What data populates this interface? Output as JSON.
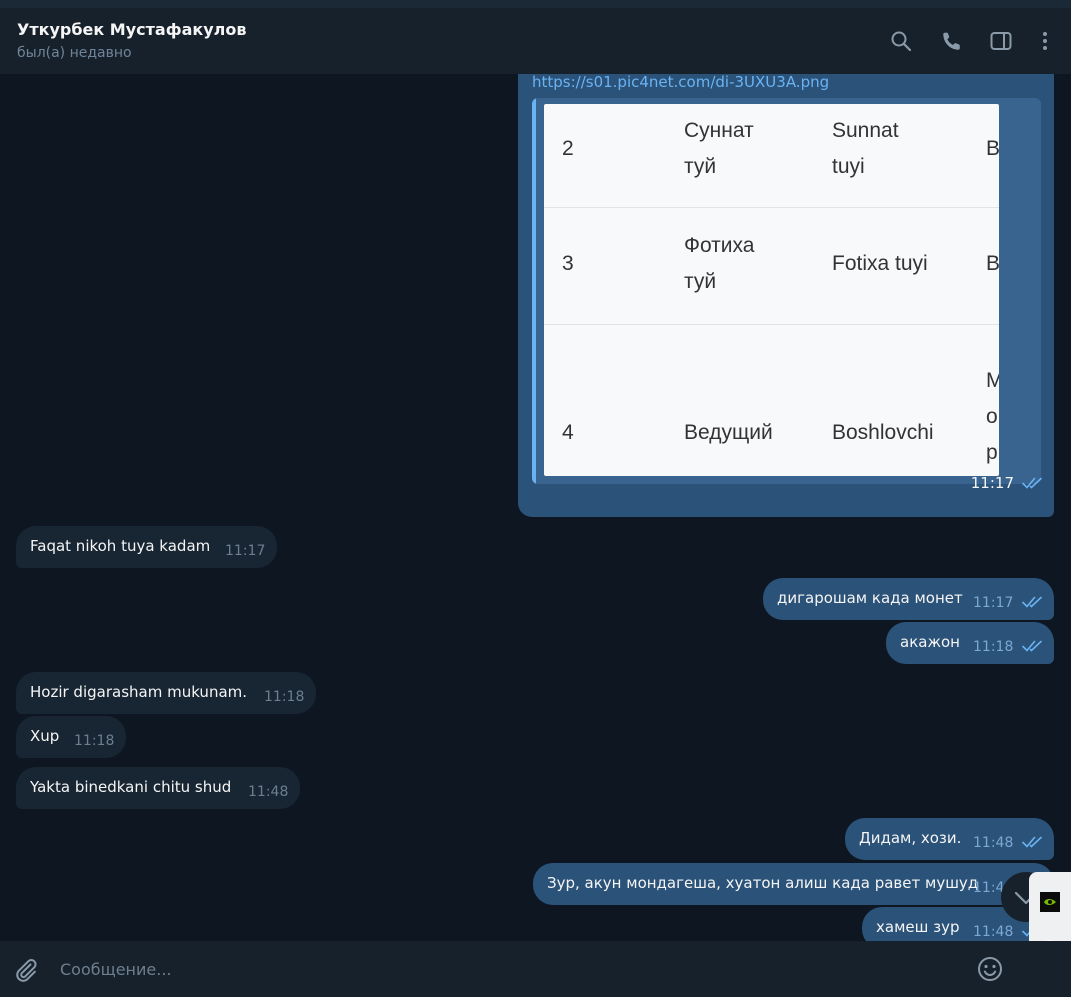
{
  "header": {
    "name": "Уткурбек Мустафакулов",
    "status": "был(а) недавно",
    "icons": [
      "search-icon",
      "phone-icon",
      "sidebar-toggle-icon",
      "more-vert-icon"
    ]
  },
  "link_message": {
    "url": "https://s01.pic4net.com/di-3UXU3A.png",
    "time": "11:17",
    "table_rows": [
      {
        "num": "2",
        "ru_1": "Суннат",
        "ru_2": "туй",
        "uz_1": "Sunnat",
        "uz_2": "tuyi",
        "extra": "B"
      },
      {
        "num": "3",
        "ru_1": "Фотиха",
        "ru_2": "туй",
        "uz_1": "Fotixa tuyi",
        "uz_2": "",
        "extra": "B"
      },
      {
        "num": "4",
        "ru_1": "Ведущий",
        "ru_2": "",
        "uz_1": "Boshlovchi",
        "uz_2": "",
        "extra_1": "M",
        "extra_2": "o",
        "extra_3": "p"
      }
    ]
  },
  "messages": [
    {
      "text": "Faqat nikoh tuya kadam",
      "time": "11:17",
      "dir": "in"
    },
    {
      "text": "дигарошам када монет",
      "time": "11:17",
      "dir": "out"
    },
    {
      "text": "акажон",
      "time": "11:18",
      "dir": "out"
    },
    {
      "text": "Hozir digarasham mukunam.",
      "time": "11:18",
      "dir": "in"
    },
    {
      "text": "Xup",
      "time": "11:18",
      "dir": "in"
    },
    {
      "text": "Yakta binedkani chitu shud",
      "time": "11:48",
      "dir": "in"
    },
    {
      "text": "Дидам, хози.",
      "time": "11:48",
      "dir": "out"
    },
    {
      "text": "Зур, акун мондагеша, хуатон алиш када равет мушуд",
      "time": "11:48",
      "dir": "out"
    },
    {
      "text": "хамеш зур",
      "time": "11:48",
      "dir": "out"
    }
  ],
  "composer": {
    "placeholder": "Сообщение..."
  },
  "colors": {
    "background": "#0e1621",
    "header": "#17212b",
    "incoming": "#182533",
    "outgoing": "#2b5278",
    "link": "#6ab3f3"
  }
}
